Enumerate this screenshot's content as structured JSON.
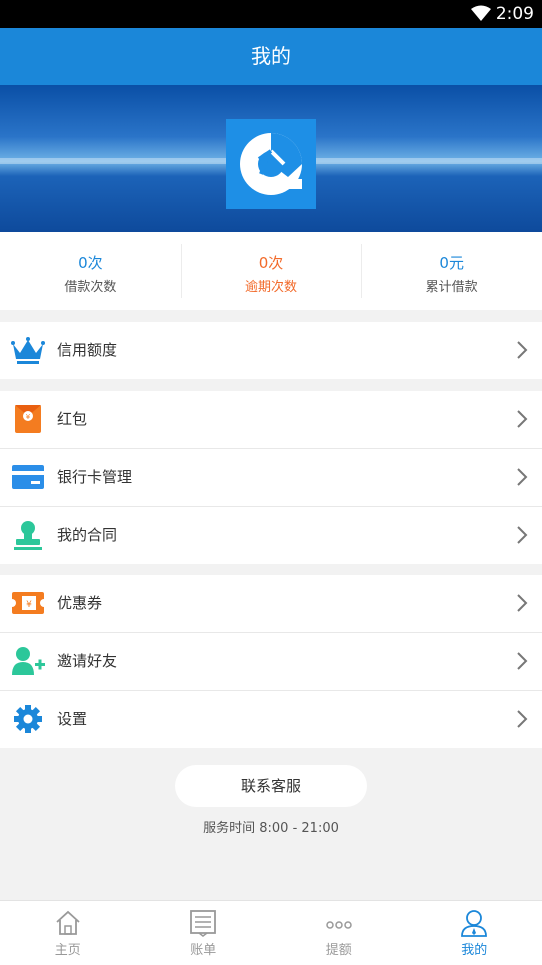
{
  "status": {
    "time": "2:09"
  },
  "header": {
    "title": "我的"
  },
  "stats": [
    {
      "value": "0次",
      "label": "借款次数"
    },
    {
      "value": "0次",
      "label": "逾期次数"
    },
    {
      "value": "0元",
      "label": "累计借款"
    }
  ],
  "menu": {
    "credit": {
      "label": "信用额度",
      "icon": "crown-icon"
    },
    "red_packet": {
      "label": "红包",
      "icon": "red-packet-icon"
    },
    "bank_card": {
      "label": "银行卡管理",
      "icon": "bank-card-icon"
    },
    "contract": {
      "label": "我的合同",
      "icon": "stamp-icon"
    },
    "coupon": {
      "label": "优惠券",
      "icon": "coupon-icon"
    },
    "invite": {
      "label": "邀请好友",
      "icon": "add-user-icon"
    },
    "settings": {
      "label": "设置",
      "icon": "gear-icon"
    }
  },
  "service": {
    "button_label": "联系客服",
    "hours": "服务时间 8:00 - 21:00"
  },
  "tabs": [
    {
      "label": "主页",
      "icon": "home-icon"
    },
    {
      "label": "账单",
      "icon": "bill-icon"
    },
    {
      "label": "提额",
      "icon": "more-icon"
    },
    {
      "label": "我的",
      "icon": "profile-icon"
    }
  ],
  "colors": {
    "accent": "#1b87d9",
    "warning": "#f26a2a"
  }
}
